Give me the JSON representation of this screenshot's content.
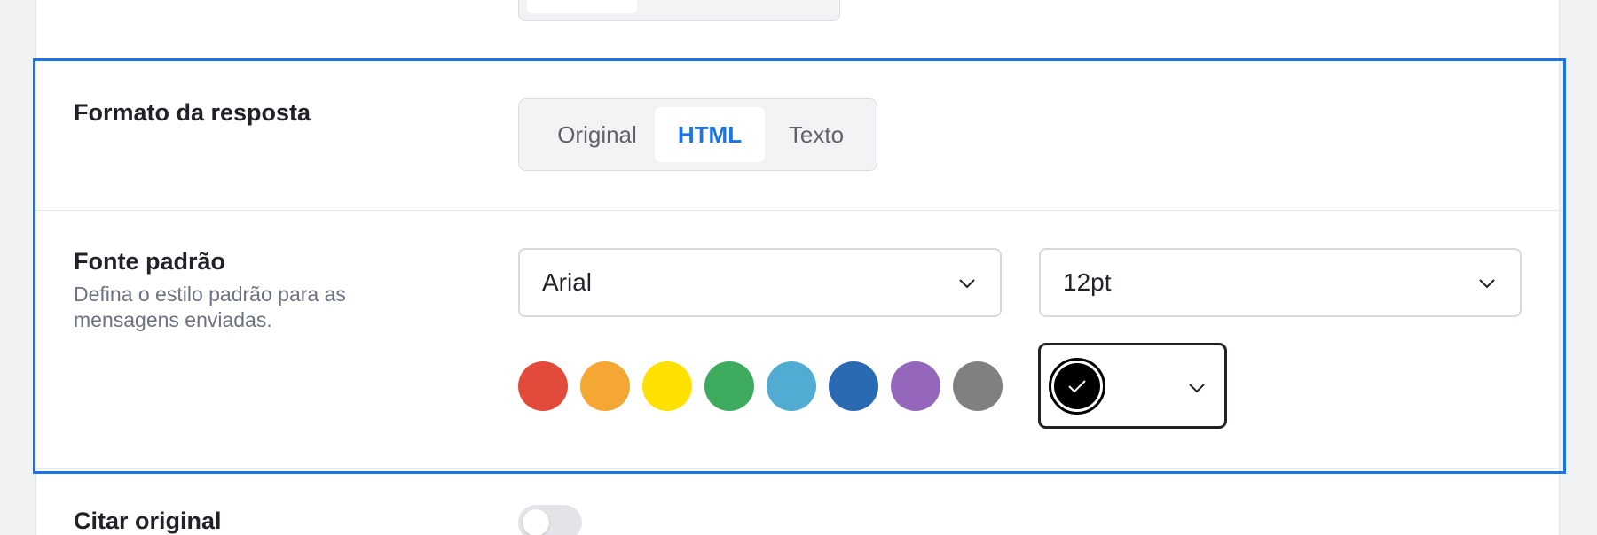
{
  "reply_format": {
    "label": "Formato da resposta",
    "options": [
      {
        "label": "Original",
        "active": false
      },
      {
        "label": "HTML",
        "active": true
      },
      {
        "label": "Texto",
        "active": false
      }
    ]
  },
  "default_font": {
    "label": "Fonte padrão",
    "description": "Defina o estilo padrão para as mensagens enviadas.",
    "family": "Arial",
    "size": "12pt",
    "colors": [
      {
        "name": "red",
        "hex": "#e24b3b"
      },
      {
        "name": "orange",
        "hex": "#f4a733"
      },
      {
        "name": "yellow",
        "hex": "#ffe000"
      },
      {
        "name": "green",
        "hex": "#3eaa5d"
      },
      {
        "name": "light-blue",
        "hex": "#52abd3"
      },
      {
        "name": "blue",
        "hex": "#2a6ab2"
      },
      {
        "name": "purple",
        "hex": "#9467bd"
      },
      {
        "name": "gray",
        "hex": "#808080"
      }
    ],
    "selected_color": {
      "name": "black",
      "hex": "#000000"
    }
  },
  "quote_original": {
    "label": "Citar original",
    "enabled": false
  },
  "colors": {
    "accent": "#1a73e8",
    "highlight_border": "#1a73e8"
  }
}
